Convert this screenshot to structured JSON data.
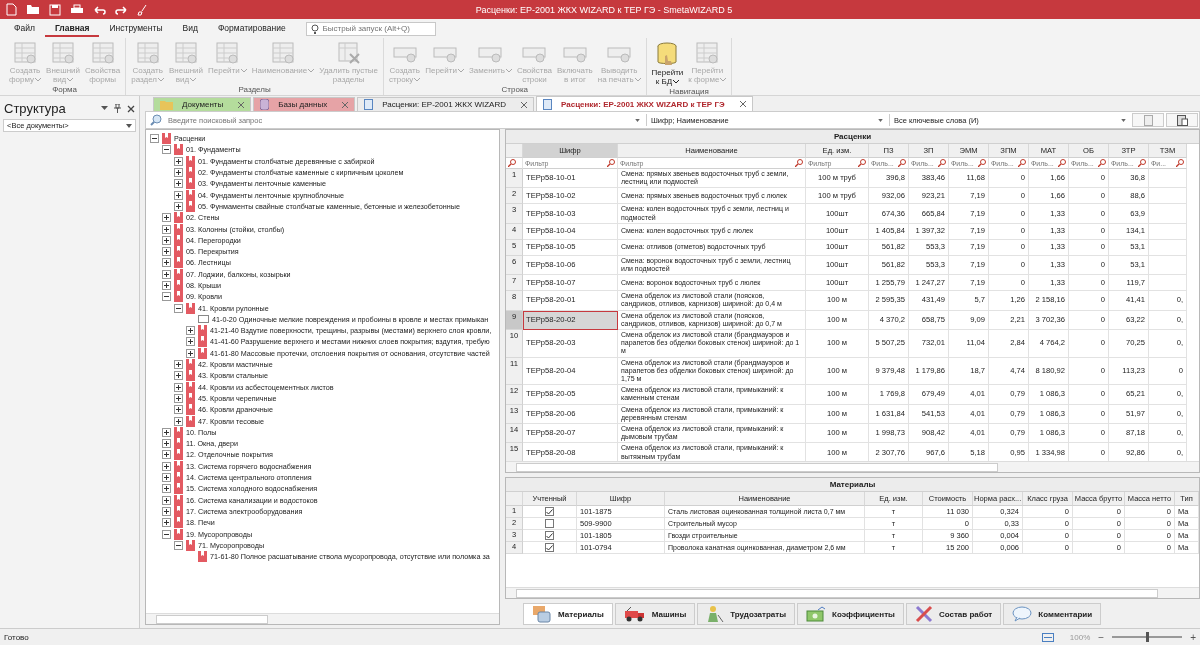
{
  "window": {
    "title": "Расценки: ЕР-2001 ЖКХ WIZARD к ТЕР ГЭ - SmetaWIZARD 5"
  },
  "menu": [
    {
      "label": "Файл",
      "selected": false
    },
    {
      "label": "Главная",
      "selected": true
    },
    {
      "label": "Инструменты",
      "selected": false
    },
    {
      "label": "Вид",
      "selected": false
    },
    {
      "label": "Форматирование",
      "selected": false
    }
  ],
  "quick_launch": {
    "placeholder": "Быстрый запуск (Alt+Q)"
  },
  "ribbon": [
    {
      "label": "Форма",
      "buttons": [
        {
          "label": "Создать\nформу",
          "kind": "table",
          "caret": true,
          "disabled": true
        },
        {
          "label": "Внешний\nвид",
          "kind": "table",
          "caret": true,
          "disabled": true
        },
        {
          "label": "Свойства\nформы",
          "kind": "table",
          "caret": false,
          "disabled": true
        }
      ]
    },
    {
      "label": "Разделы",
      "buttons": [
        {
          "label": "Создать\nраздел",
          "kind": "table",
          "caret": true,
          "disabled": true
        },
        {
          "label": "Внешний\nвид",
          "kind": "table",
          "caret": true,
          "disabled": true
        },
        {
          "label": "Перейти",
          "kind": "table",
          "caret": true,
          "disabled": true
        },
        {
          "label": "Наименование",
          "kind": "table",
          "caret": true,
          "disabled": true
        },
        {
          "label": "Удалить пустые\nразделы",
          "kind": "delete",
          "caret": false,
          "disabled": true
        }
      ]
    },
    {
      "label": "Строка",
      "buttons": [
        {
          "label": "Создать\nстроку",
          "kind": "row",
          "caret": true,
          "disabled": true
        },
        {
          "label": "Перейти",
          "kind": "row",
          "caret": true,
          "disabled": true
        },
        {
          "label": "Заменить",
          "kind": "row",
          "caret": true,
          "disabled": true
        },
        {
          "label": "Свойства\nстроки",
          "kind": "row",
          "caret": false,
          "disabled": true
        },
        {
          "label": "Включать\nв итог",
          "kind": "row",
          "caret": false,
          "disabled": true
        },
        {
          "label": "Выводить\nна печать",
          "kind": "row",
          "caret": true,
          "disabled": true
        }
      ]
    },
    {
      "label": "Навигация",
      "buttons": [
        {
          "label": "Перейти\nк БД",
          "kind": "database",
          "caret": true,
          "disabled": false
        },
        {
          "label": "Перейти\nк форме",
          "kind": "table",
          "caret": true,
          "disabled": true
        }
      ]
    }
  ],
  "structure": {
    "title": "Структура",
    "filter": "<Все документы>"
  },
  "doc_tabs": [
    {
      "label": "Документы",
      "kind": "folder",
      "color": "#b4dc9c",
      "selected": false
    },
    {
      "label": "Базы данных",
      "kind": "database",
      "color": "#e6a3a6",
      "selected": false
    },
    {
      "label": "Расценки: ЕР-2001 ЖКХ WIZARD",
      "kind": "document",
      "color": "#ececec",
      "selected": false
    },
    {
      "label": "Расценки: ЕР-2001 ЖКХ WIZARD к ТЕР ГЭ",
      "kind": "document",
      "color": "#ffffff",
      "selected": true
    }
  ],
  "search": {
    "placeholder": "Введите поисковый запрос"
  },
  "search_fields": "Шифр; Наименование",
  "search_mode": "Все ключевые слова (И)",
  "tree": {
    "nodes": [
      {
        "label": "Расценки",
        "kind": "section",
        "expanded": true,
        "children": [
          {
            "label": "01. Фундаменты",
            "kind": "section",
            "expanded": true,
            "children": [
              {
                "label": "01. Фундаменты столбчатые деревянные с забиркой",
                "kind": "section",
                "expanded": false
              },
              {
                "label": "02. Фундаменты столбчатые каменные с кирпичным цоколем",
                "kind": "section",
                "expanded": false
              },
              {
                "label": "03. Фундаменты ленточные каменные",
                "kind": "section",
                "expanded": false
              },
              {
                "label": "04. Фундаменты ленточные крупноблочные",
                "kind": "section",
                "expanded": false
              },
              {
                "label": "05. Фунмаменты свайные столбчатые каменные, бетонные и железобетонные",
                "kind": "section",
                "expanded": false
              }
            ]
          },
          {
            "label": "02. Стены",
            "kind": "section",
            "expanded": false
          },
          {
            "label": "03. Колонны (стойки, столбы)",
            "kind": "section",
            "expanded": false
          },
          {
            "label": "04. Перегородки",
            "kind": "section",
            "expanded": false
          },
          {
            "label": "05. Перекрытия",
            "kind": "section",
            "expanded": false
          },
          {
            "label": "06. Лестницы",
            "kind": "section",
            "expanded": false
          },
          {
            "label": "07. Лоджии, балконы, козырьки",
            "kind": "section",
            "expanded": false
          },
          {
            "label": "08. Крыши",
            "kind": "section",
            "expanded": false
          },
          {
            "label": "09. Кровли",
            "kind": "section",
            "expanded": true,
            "children": [
              {
                "label": "41. Кровли рулонные",
                "kind": "section",
                "expanded": true,
                "children": [
                  {
                    "label": "41-0-20 Одиночные мелкие повреждения и пробоины в кровле и местах примыкан",
                    "kind": "entry"
                  },
                  {
                    "label": "41-21-40 Вздутие поверхности, трещины, разрывы (местами) верхнего слоя кровли,",
                    "kind": "section",
                    "expanded": false
                  },
                  {
                    "label": "41-41-60 Разрушение верхнего и местами нижних слоев покрытия; вздутия, требую",
                    "kind": "section",
                    "expanded": false
                  },
                  {
                    "label": "41-61-80 Массовые протечки, отслоения покрытия от основания, отсутствие частей",
                    "kind": "section",
                    "expanded": false
                  }
                ]
              },
              {
                "label": "42. Кровли мастичные",
                "kind": "section",
                "expanded": false
              },
              {
                "label": "43. Кровли стальные",
                "kind": "section",
                "expanded": false
              },
              {
                "label": "44. Кровли из асбестоцементных листов",
                "kind": "section",
                "expanded": false
              },
              {
                "label": "45. Кровли черепичные",
                "kind": "section",
                "expanded": false
              },
              {
                "label": "46. Кровли драночные",
                "kind": "section",
                "expanded": false
              },
              {
                "label": "47. Кровли тесовые",
                "kind": "section",
                "expanded": false
              }
            ]
          },
          {
            "label": "10. Полы",
            "kind": "section",
            "expanded": false
          },
          {
            "label": "11. Окна, двери",
            "kind": "section",
            "expanded": false
          },
          {
            "label": "12. Отделочные покрытия",
            "kind": "section",
            "expanded": false
          },
          {
            "label": "13. Система горячего водоснабжения",
            "kind": "section",
            "expanded": false
          },
          {
            "label": "14. Система центрального отопления",
            "kind": "section",
            "expanded": false
          },
          {
            "label": "15. Система холодного водоснабжения",
            "kind": "section",
            "expanded": false
          },
          {
            "label": "16. Система канализации и водостоков",
            "kind": "section",
            "expanded": false
          },
          {
            "label": "17. Система электрооборудования",
            "kind": "section",
            "expanded": false
          },
          {
            "label": "18. Печи",
            "kind": "section",
            "expanded": false
          },
          {
            "label": "19. Мусоропроводы",
            "kind": "section",
            "expanded": true,
            "children": [
              {
                "label": "71. Мусоропроводы",
                "kind": "section",
                "expanded": true,
                "children": [
                  {
                    "label": "71-61-80 Полное расшатывание ствола мусоропровода, отсутствие или поломка за",
                    "kind": "end"
                  }
                ]
              }
            ]
          }
        ]
      }
    ]
  },
  "rates": {
    "title": "Расценки",
    "columns": [
      {
        "title": "Шифр",
        "filter": "Фильтр"
      },
      {
        "title": "Наименование",
        "filter": "Фильтр"
      },
      {
        "title": "Ед. изм.",
        "filter": "Фильтр"
      },
      {
        "title": "ПЗ",
        "filter": "Филь..."
      },
      {
        "title": "ЗП",
        "filter": "Филь..."
      },
      {
        "title": "ЭММ",
        "filter": "Филь..."
      },
      {
        "title": "ЗПМ",
        "filter": "Филь..."
      },
      {
        "title": "МАТ",
        "filter": "Филь..."
      },
      {
        "title": "ОБ",
        "filter": "Филь..."
      },
      {
        "title": "ЗТР",
        "filter": "Филь..."
      },
      {
        "title": "ТЗМ",
        "filter": "Фи..."
      }
    ],
    "rows": [
      {
        "num": "1",
        "code": "ТЕРр58-10-01",
        "name": "Смена: прямых звеньев водосточных труб с земли, лестниц или подмостей",
        "unit": "100 м труб",
        "values": [
          "396,8",
          "383,46",
          "11,68",
          "0",
          "1,66",
          "0",
          "36,8"
        ],
        "selected": false
      },
      {
        "num": "2",
        "code": "ТЕРр58-10-02",
        "name": "Смена: прямых звеньев водосточных труб с люлек",
        "unit": "100 м труб",
        "values": [
          "932,06",
          "923,21",
          "7,19",
          "0",
          "1,66",
          "0",
          "88,6"
        ],
        "selected": false
      },
      {
        "num": "3",
        "code": "ТЕРр58-10-03",
        "name": "Смена: колен водосточных труб с земли, лестниц и подмостей",
        "unit": "100шт",
        "values": [
          "674,36",
          "665,84",
          "7,19",
          "0",
          "1,33",
          "0",
          "63,9"
        ],
        "selected": false
      },
      {
        "num": "4",
        "code": "ТЕРр58-10-04",
        "name": "Смена: колен водосточных труб с люлек",
        "unit": "100шт",
        "values": [
          "1 405,84",
          "1 397,32",
          "7,19",
          "0",
          "1,33",
          "0",
          "134,1"
        ],
        "selected": false
      },
      {
        "num": "5",
        "code": "ТЕРр58-10-05",
        "name": "Смена: отливов (отметов) водосточных труб",
        "unit": "100шт",
        "values": [
          "561,82",
          "553,3",
          "7,19",
          "0",
          "1,33",
          "0",
          "53,1"
        ],
        "selected": false
      },
      {
        "num": "6",
        "code": "ТЕРр58-10-06",
        "name": "Смена: воронок водосточных труб с земли, лестниц или подмостей",
        "unit": "100шт",
        "values": [
          "561,82",
          "553,3",
          "7,19",
          "0",
          "1,33",
          "0",
          "53,1"
        ],
        "selected": false
      },
      {
        "num": "7",
        "code": "ТЕРр58-10-07",
        "name": "Смена: воронок водосточных труб с люлек",
        "unit": "100шт",
        "values": [
          "1 255,79",
          "1 247,27",
          "7,19",
          "0",
          "1,33",
          "0",
          "119,7"
        ],
        "selected": false
      },
      {
        "num": "8",
        "code": "ТЕРр58-20-01",
        "name": "Смена обделок из листовой стали (поясков, сандриков, отливов, карнизов) шириной: до 0,4 м",
        "unit": "100 м",
        "values": [
          "2 595,35",
          "431,49",
          "5,7",
          "1,26",
          "2 158,16",
          "0",
          "41,41",
          "0,"
        ],
        "selected": false
      },
      {
        "num": "9",
        "code": "ТЕРр58-20-02",
        "name": "Смена обделок из листовой стали (поясков, сандриков, отливов, карнизов) шириной: до 0,7 м",
        "unit": "100 м",
        "values": [
          "4 370,2",
          "658,75",
          "9,09",
          "2,21",
          "3 702,36",
          "0",
          "63,22",
          "0,"
        ],
        "selected": true
      },
      {
        "num": "10",
        "code": "ТЕРр58-20-03",
        "name": "Смена обделок из листовой стали (брандмауэров и парапетов без обделки боковых стенок) шириной: до 1 м",
        "unit": "100 м",
        "values": [
          "5 507,25",
          "732,01",
          "11,04",
          "2,84",
          "4 764,2",
          "0",
          "70,25",
          "0,"
        ],
        "selected": false
      },
      {
        "num": "11",
        "code": "ТЕРр58-20-04",
        "name": "Смена обделок из листовой стали (брандмауэров и парапетов без обделки боковых стенок) шириной: до 1,75 м",
        "unit": "100 м",
        "values": [
          "9 379,48",
          "1 179,86",
          "18,7",
          "4,74",
          "8 180,92",
          "0",
          "113,23",
          "0"
        ],
        "selected": false
      },
      {
        "num": "12",
        "code": "ТЕРр58-20-05",
        "name": "Смена обделок из листовой стали, примыканий: к каменным стенам",
        "unit": "100 м",
        "values": [
          "1 769,8",
          "679,49",
          "4,01",
          "0,79",
          "1 086,3",
          "0",
          "65,21",
          "0,"
        ],
        "selected": false
      },
      {
        "num": "13",
        "code": "ТЕРр58-20-06",
        "name": "Смена обделок из листовой стали, примыканий: к деревянным стенам",
        "unit": "100 м",
        "values": [
          "1 631,84",
          "541,53",
          "4,01",
          "0,79",
          "1 086,3",
          "0",
          "51,97",
          "0,"
        ],
        "selected": false
      },
      {
        "num": "14",
        "code": "ТЕРр58-20-07",
        "name": "Смена обделок из листовой стали, примыканий: к дымовым трубам",
        "unit": "100 м",
        "values": [
          "1 998,73",
          "908,42",
          "4,01",
          "0,79",
          "1 086,3",
          "0",
          "87,18",
          "0,"
        ],
        "selected": false
      },
      {
        "num": "15",
        "code": "ТЕРр58-20-08",
        "name": "Смена обделок из листовой стали, примыканий: к вытяжным трубам",
        "unit": "100 м",
        "values": [
          "2 307,76",
          "967,6",
          "5,18",
          "0,95",
          "1 334,98",
          "0",
          "92,86",
          "0,"
        ],
        "selected": false
      }
    ]
  },
  "materials": {
    "title": "Материалы",
    "columns": [
      "Учтенный",
      "Шифр",
      "Наименование",
      "Ед. изм.",
      "Стоимость",
      "Норма расх...",
      "Класс груза",
      "Масса брутто",
      "Масса нетто",
      "Тип"
    ],
    "rows": [
      {
        "num": "1",
        "checked": true,
        "code": "101-1875",
        "name": "Сталь листовая оцинкованная толщиной листа 0,7 мм",
        "unit": "т",
        "values": [
          "11 030",
          "0,324",
          "0",
          "0",
          "0"
        ],
        "type": "Ма"
      },
      {
        "num": "2",
        "checked": false,
        "code": "509-9900",
        "name": "Строительный мусор",
        "unit": "т",
        "values": [
          "0",
          "0,33",
          "0",
          "0",
          "0"
        ],
        "type": "Ма"
      },
      {
        "num": "3",
        "checked": true,
        "code": "101-1805",
        "name": "Гвозди строительные",
        "unit": "т",
        "values": [
          "9 360",
          "0,004",
          "0",
          "0",
          "0"
        ],
        "type": "Ма"
      },
      {
        "num": "4",
        "checked": true,
        "code": "101-0794",
        "name": "Проволока канатная оцинкованная, диаметром 2,6 мм",
        "unit": "т",
        "values": [
          "15 200",
          "0,006",
          "0",
          "0",
          "0"
        ],
        "type": "Ма"
      }
    ]
  },
  "detail_tabs": [
    {
      "label": "Материалы",
      "kind": "materials",
      "selected": true
    },
    {
      "label": "Машины",
      "kind": "machines",
      "selected": false
    },
    {
      "label": "Трудозатраты",
      "kind": "labor",
      "selected": false
    },
    {
      "label": "Коэффициенты",
      "kind": "factors",
      "selected": false
    },
    {
      "label": "Состав работ",
      "kind": "works",
      "selected": false
    },
    {
      "label": "Комментарии",
      "kind": "comments",
      "selected": false
    }
  ],
  "status_bar": {
    "text": "Готово",
    "zoom": "100%",
    "minus": "−",
    "plus": "+",
    "level": 0.5
  }
}
